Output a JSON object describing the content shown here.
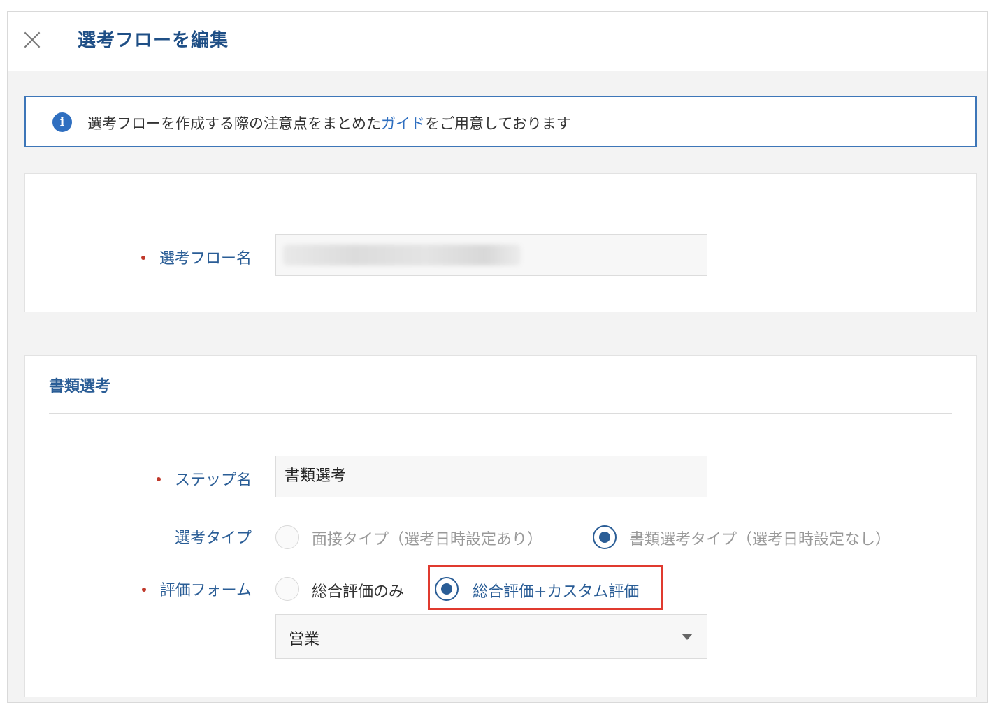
{
  "header": {
    "title": "選考フローを編集"
  },
  "notice": {
    "text_before": "選考フローを作成する際の注意点をまとめた",
    "link_text": "ガイド",
    "text_after": "をご用意しております",
    "icon_glyph": "i",
    "icon": "info-icon"
  },
  "flow_name": {
    "label": "選考フロー名",
    "value_blurred": true
  },
  "step_section": {
    "title": "書類選考",
    "step_name_label": "ステップ名",
    "step_name_value": "書類選考",
    "selection_type_label": "選考タイプ",
    "selection_type_options": [
      {
        "label": "面接タイプ（選考日時設定あり）",
        "checked": false,
        "disabled": true
      },
      {
        "label": "書類選考タイプ（選考日時設定なし）",
        "checked": true,
        "disabled": true
      }
    ],
    "eval_form_label": "評価フォーム",
    "eval_form_options": [
      {
        "label": "総合評価のみ",
        "checked": false
      },
      {
        "label": "総合評価+カスタム評価",
        "checked": true
      }
    ],
    "eval_template_value": "営業"
  },
  "colors": {
    "accent": "#2a5d96",
    "link": "#2f6fc0",
    "required": "#c0392b",
    "highlight": "#e03a2f"
  }
}
